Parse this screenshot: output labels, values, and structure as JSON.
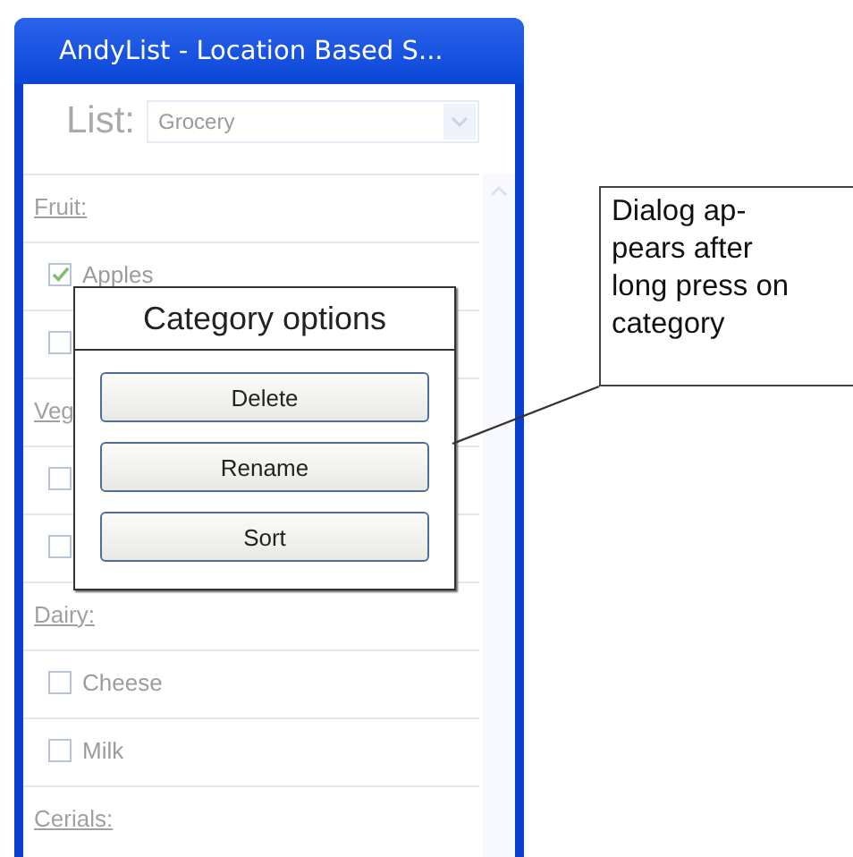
{
  "window": {
    "title": "AndyList - Location Based S..."
  },
  "list_selector": {
    "label": "List:",
    "value": "Grocery"
  },
  "rows": [
    {
      "kind": "category",
      "label": "Fruit:"
    },
    {
      "kind": "item",
      "label": "Apples",
      "checked": true
    },
    {
      "kind": "item",
      "checked": false
    },
    {
      "kind": "category",
      "label": "Veg"
    },
    {
      "kind": "item",
      "checked": false
    },
    {
      "kind": "item",
      "checked": false
    },
    {
      "kind": "category",
      "label": "Dairy:"
    },
    {
      "kind": "item",
      "label": "Cheese",
      "checked": false
    },
    {
      "kind": "item",
      "label": "Milk",
      "checked": false
    },
    {
      "kind": "category",
      "label": "Cerials:"
    }
  ],
  "dialog": {
    "title": "Category options",
    "buttons": [
      "Delete",
      "Rename",
      "Sort"
    ]
  },
  "annotation": {
    "text": "Dialog ap-\npears after\nlong press on\ncategory"
  }
}
